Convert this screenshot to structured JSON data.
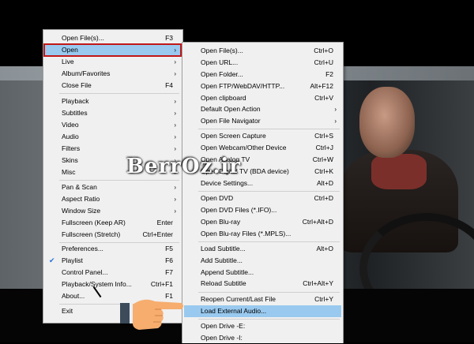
{
  "watermark": "BerrOz.ir",
  "menu_main": {
    "items": [
      {
        "label": "Open File(s)...",
        "shortcut": "F3"
      },
      {
        "label": "Open",
        "arrow": "›"
      },
      {
        "label": "Live",
        "arrow": "›"
      },
      {
        "label": "Album/Favorites",
        "arrow": "›"
      },
      {
        "label": "Close File",
        "shortcut": "F4"
      },
      {
        "label": "Playback",
        "arrow": "›"
      },
      {
        "label": "Subtitles",
        "arrow": "›"
      },
      {
        "label": "Video",
        "arrow": "›"
      },
      {
        "label": "Audio",
        "arrow": "›"
      },
      {
        "label": "Filters",
        "arrow": "›"
      },
      {
        "label": "Skins",
        "arrow": "›"
      },
      {
        "label": "Misc",
        "arrow": "›"
      },
      {
        "label": "Pan & Scan",
        "arrow": "›"
      },
      {
        "label": "Aspect Ratio",
        "arrow": "›"
      },
      {
        "label": "Window Size",
        "arrow": "›"
      },
      {
        "label": "Fullscreen (Keep AR)",
        "shortcut": "Enter"
      },
      {
        "label": "Fullscreen (Stretch)",
        "shortcut": "Ctrl+Enter"
      },
      {
        "label": "Preferences...",
        "shortcut": "F5"
      },
      {
        "label": "Playlist",
        "shortcut": "F6",
        "check": "✔"
      },
      {
        "label": "Control Panel...",
        "shortcut": "F7"
      },
      {
        "label": "Playback/System Info...",
        "shortcut": "Ctrl+F1"
      },
      {
        "label": "About...",
        "shortcut": "F1"
      },
      {
        "label": "Exit",
        "shortcut": ""
      }
    ]
  },
  "menu_open": {
    "items": [
      {
        "label": "Open File(s)...",
        "shortcut": "Ctrl+O"
      },
      {
        "label": "Open URL...",
        "shortcut": "Ctrl+U"
      },
      {
        "label": "Open Folder...",
        "shortcut": "F2"
      },
      {
        "label": "Open FTP/WebDAV/HTTP...",
        "shortcut": "Alt+F12"
      },
      {
        "label": "Open clipboard",
        "shortcut": "Ctrl+V"
      },
      {
        "label": "Default Open Action",
        "arrow": "›"
      },
      {
        "label": "Open File Navigator",
        "arrow": "›"
      },
      {
        "label": "Open Screen Capture",
        "shortcut": "Ctrl+S"
      },
      {
        "label": "Open Webcam/Other Device",
        "shortcut": "Ctrl+J"
      },
      {
        "label": "Open Analog TV",
        "shortcut": "Ctrl+W"
      },
      {
        "label": "Open Digital TV (BDA device)",
        "shortcut": "Ctrl+K"
      },
      {
        "label": "Device Settings...",
        "shortcut": "Alt+D"
      },
      {
        "label": "Open DVD",
        "shortcut": "Ctrl+D"
      },
      {
        "label": "Open DVD Files (*.IFO)...",
        "shortcut": ""
      },
      {
        "label": "Open Blu-ray",
        "shortcut": "Ctrl+Alt+D"
      },
      {
        "label": "Open Blu-ray Files (*.MPLS)...",
        "shortcut": ""
      },
      {
        "label": "Load Subtitle...",
        "shortcut": "Alt+O"
      },
      {
        "label": "Add Subtitle...",
        "shortcut": ""
      },
      {
        "label": "Append Subtitle...",
        "shortcut": ""
      },
      {
        "label": "Reload Subtitle",
        "shortcut": "Ctrl+Alt+Y"
      },
      {
        "label": "Reopen Current/Last File",
        "shortcut": "Ctrl+Y"
      },
      {
        "label": "Load External Audio...",
        "shortcut": ""
      },
      {
        "label": "Open Drive -E:",
        "shortcut": ""
      },
      {
        "label": "Open Drive -I:",
        "shortcut": ""
      }
    ]
  },
  "colors": {
    "highlight": "#99c9ef",
    "outline": "#c01818",
    "menu_bg": "#f0f0f0"
  }
}
